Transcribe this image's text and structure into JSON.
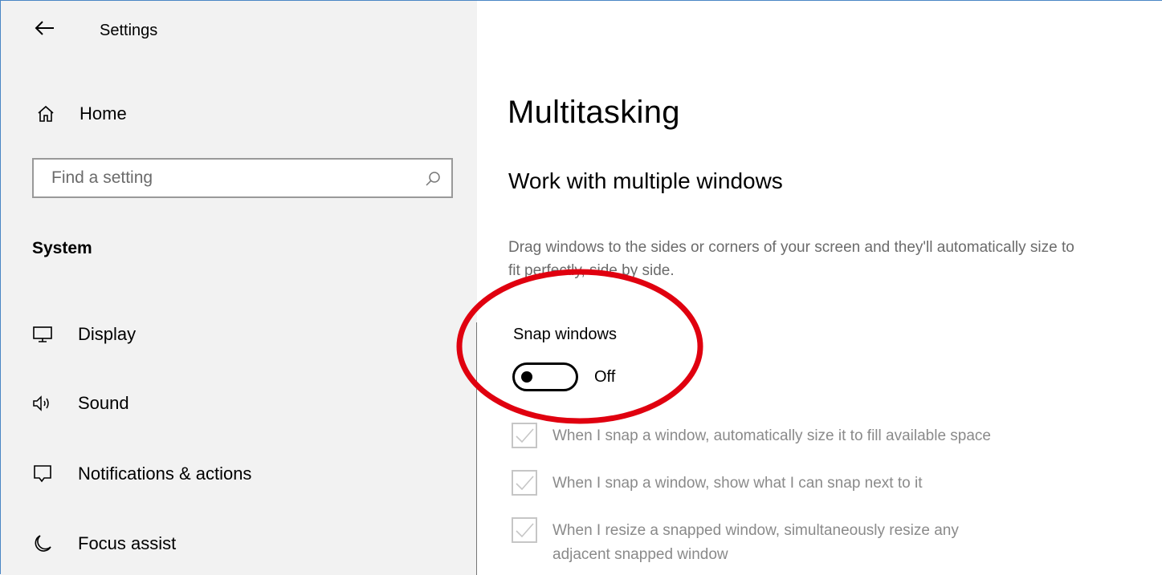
{
  "window": {
    "title": "Settings",
    "border_color": "#4a86c5"
  },
  "nav": {
    "back_icon": "arrow-left-icon",
    "home_label": "Home",
    "home_icon": "home-icon",
    "search_placeholder": "Find a setting",
    "search_icon": "search-icon",
    "section": "System",
    "items": [
      {
        "label": "Display",
        "icon": "monitor-icon"
      },
      {
        "label": "Sound",
        "icon": "speaker-icon"
      },
      {
        "label": "Notifications & actions",
        "icon": "message-icon"
      },
      {
        "label": "Focus assist",
        "icon": "moon-icon"
      }
    ]
  },
  "main": {
    "title": "Multitasking",
    "section_title": "Work with multiple windows",
    "description": "Drag windows to the sides or corners of your screen and they'll automatically size to fit perfectly, side by side.",
    "snap": {
      "label": "Snap windows",
      "toggle_state": "Off",
      "toggle_on": false
    },
    "options": [
      {
        "label": "When I snap a window, automatically size it to fill available space",
        "checked": true,
        "disabled": true
      },
      {
        "label": "When I snap a window, show what I can snap next to it",
        "checked": true,
        "disabled": true
      },
      {
        "label": "When I resize a snapped window, simultaneously resize any adjacent snapped window",
        "checked": true,
        "disabled": true
      }
    ]
  },
  "annotation": {
    "shape": "ellipse",
    "color": "#e0000f"
  },
  "colors": {
    "sidebar_bg": "#f2f2f2",
    "disabled_text": "#8a8a8a",
    "secondary_text": "#6b6b6b"
  }
}
